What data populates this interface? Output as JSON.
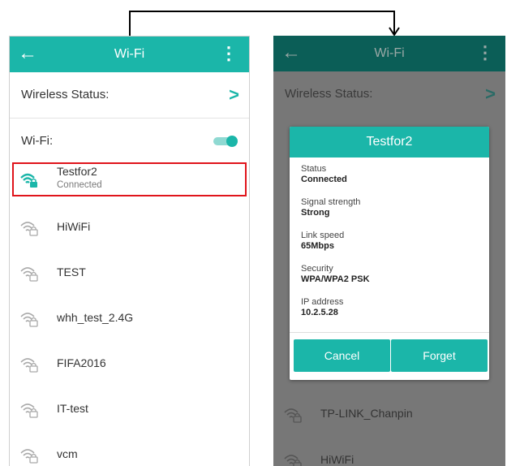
{
  "left": {
    "title": "Wi-Fi",
    "wireless_status_label": "Wireless Status:",
    "wifi_label": "Wi-Fi:",
    "networks": [
      {
        "name": "Testfor2",
        "status": "Connected"
      },
      {
        "name": "HiWiFi"
      },
      {
        "name": "TEST"
      },
      {
        "name": "whh_test_2.4G"
      },
      {
        "name": "FIFA2016"
      },
      {
        "name": "IT-test"
      },
      {
        "name": "vcm"
      }
    ]
  },
  "right": {
    "title": "Wi-Fi",
    "wireless_status_label": "Wireless Status:",
    "dialog": {
      "title": "Testfor2",
      "status_label": "Status",
      "status_value": "Connected",
      "signal_label": "Signal strength",
      "signal_value": "Strong",
      "speed_label": "Link speed",
      "speed_value": "65Mbps",
      "security_label": "Security",
      "security_value": "WPA/WPA2 PSK",
      "ip_label": "IP address",
      "ip_value": "10.2.5.28",
      "cancel_label": "Cancel",
      "forget_label": "Forget"
    },
    "networks_below": [
      {
        "name": "TP-LINK_Chanpin"
      },
      {
        "name": "HiWiFi"
      }
    ]
  },
  "colors": {
    "accent": "#1bb6a9",
    "dim_appbar": "#0b5e57",
    "highlight": "#e0141b",
    "overlay": "#777777"
  }
}
